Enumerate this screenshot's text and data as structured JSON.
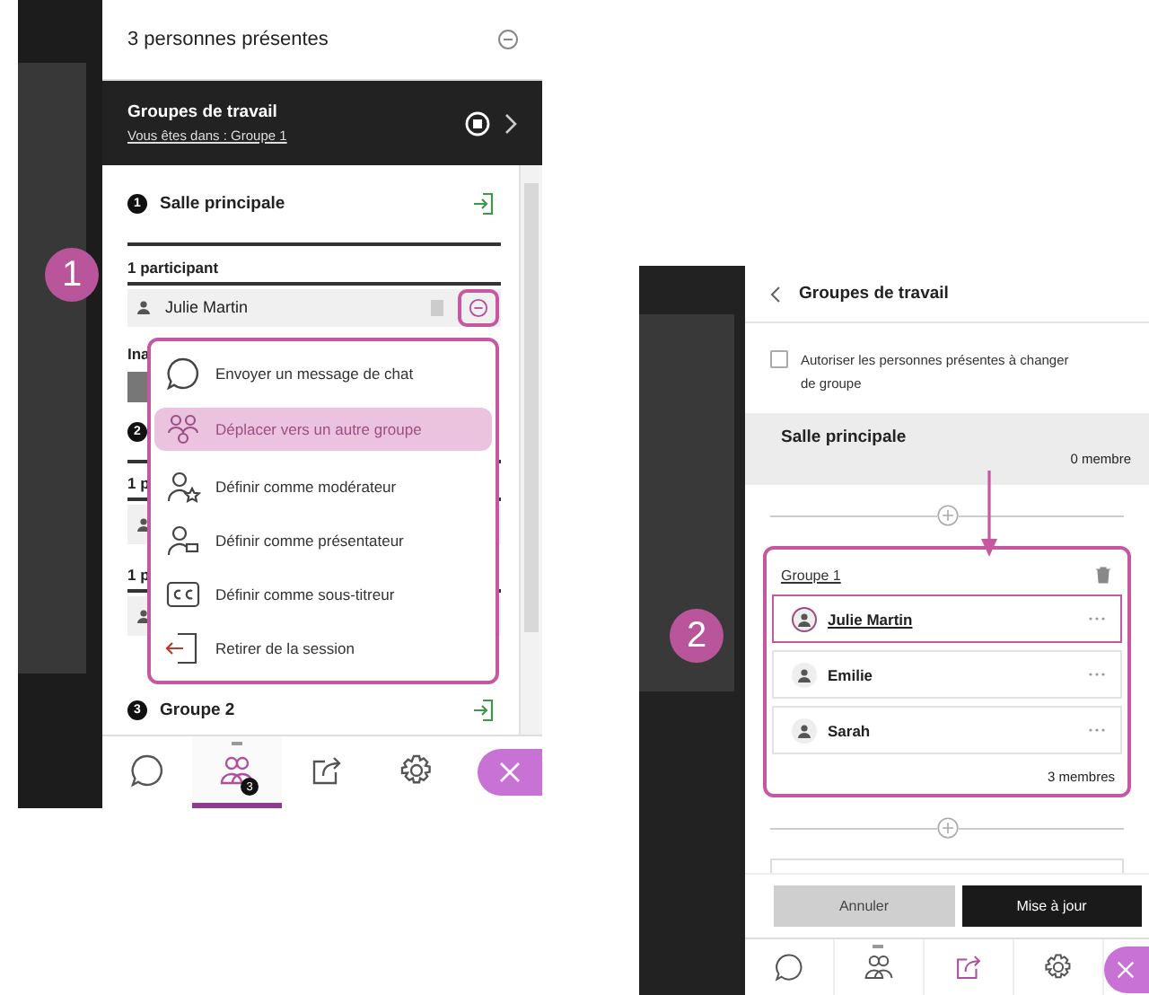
{
  "callouts": [
    {
      "label": "1"
    },
    {
      "label": "2"
    }
  ],
  "attendees_panel": {
    "title": "3 personnes présentes",
    "breakout_bar": {
      "title": "Groupes de travail",
      "subtitle": "Vous êtes dans : Groupe 1"
    },
    "main_room": {
      "number": "1",
      "title": "Salle principale",
      "count": "1 participant",
      "participant": "Julie Martin"
    },
    "label_fragment": "Ina",
    "group_two": {
      "number": "2",
      "count_fragments": [
        "1 p",
        "1 p"
      ]
    },
    "next_group": {
      "number": "3",
      "title": "Groupe 2"
    },
    "menu": [
      {
        "kind": "chat",
        "label": "Envoyer un message de chat",
        "selected": false
      },
      {
        "kind": "move",
        "label": "Déplacer vers un autre groupe",
        "selected": true
      },
      {
        "kind": "moderator",
        "label": "Définir comme modérateur",
        "selected": false
      },
      {
        "kind": "presenter",
        "label": "Définir comme présentateur",
        "selected": false
      },
      {
        "kind": "captioner",
        "label": "Définir comme sous-titreur",
        "selected": false
      },
      {
        "kind": "remove",
        "label": "Retirer de la session",
        "selected": false
      }
    ],
    "tabs": [
      {
        "kind": "chat",
        "selected": false
      },
      {
        "kind": "people",
        "selected": true,
        "badge": "3"
      },
      {
        "kind": "share",
        "selected": false
      },
      {
        "kind": "settings",
        "selected": false
      },
      {
        "kind": "close",
        "selected": false
      }
    ]
  },
  "groups_panel": {
    "title": "Groupes de travail",
    "allow_switch": {
      "label": "Autoriser les personnes présentes à changer de groupe",
      "checked": false
    },
    "main_room": {
      "title": "Salle principale",
      "count": "0 membre"
    },
    "group": {
      "name": "Groupe 1",
      "count": "3 membres",
      "members": [
        {
          "name": "Julie Martin",
          "selected": true
        },
        {
          "name": "Emilie",
          "selected": false
        },
        {
          "name": "Sarah",
          "selected": false
        }
      ]
    },
    "buttons": [
      {
        "kind": "secondary",
        "label": "Annuler"
      },
      {
        "kind": "primary",
        "label": "Mise à jour"
      }
    ],
    "tabs": [
      {
        "kind": "chat",
        "selected": false
      },
      {
        "kind": "people",
        "selected": false
      },
      {
        "kind": "share",
        "selected": true
      },
      {
        "kind": "settings",
        "selected": false
      },
      {
        "kind": "close",
        "selected": false
      }
    ]
  }
}
